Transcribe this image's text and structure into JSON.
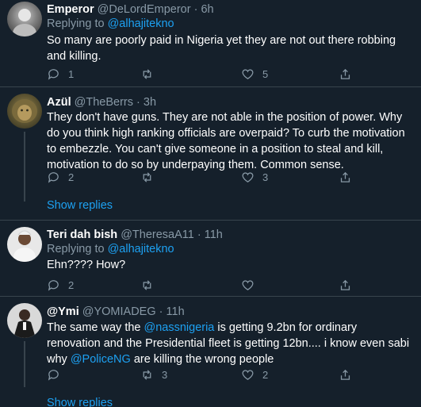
{
  "tweets": [
    {
      "name": "Emperor",
      "handle": "@DeLordEmperor",
      "time": "· 6h",
      "replying_prefix": "Replying to ",
      "replying_to": "@alhajitekno",
      "text": "So many are poorly paid in Nigeria yet they are not out there robbing and killing.",
      "replies": "1",
      "retweets": "",
      "likes": "5",
      "avatar_icon": "avatar-photo-icon"
    },
    {
      "name": "Azül",
      "handle": "@TheBerrs",
      "time": "· 3h",
      "text": "They don't have guns. They are not able in the position of power. Why do you think high ranking officials are overpaid? To curb the motivation to embezzle. You can't give someone in a position to steal and kill, motivation to do so by underpaying them. Common sense.",
      "replies": "2",
      "retweets": "",
      "likes": "3",
      "show_replies": "Show replies",
      "avatar_icon": "lion-avatar-icon"
    },
    {
      "name": "Teri dah bish",
      "handle": "@TheresaA11",
      "time": "· 11h",
      "replying_prefix": "Replying to ",
      "replying_to": "@alhajitekno",
      "text": "Ehn???? How?",
      "replies": "2",
      "retweets": "",
      "likes": "",
      "avatar_icon": "avatar-photo-icon"
    },
    {
      "name": "@Ymi",
      "handle": "@YOMIADEG",
      "time": "· 11h",
      "text_parts": {
        "a": "The same way the ",
        "mention1": "@nassnigeria",
        "b": " is getting 9.2bn for ordinary renovation and the Presidential fleet is getting 12bn.... i know even sabi why ",
        "mention2": "@PoliceNG",
        "c": " are killing the wrong people"
      },
      "replies": "",
      "retweets": "3",
      "likes": "2",
      "show_replies": "Show replies",
      "avatar_icon": "avatar-photo-icon"
    }
  ],
  "colors": {
    "background": "#15202b",
    "secondary_text": "#8899a6",
    "link": "#1da1f2",
    "divider": "#38444d"
  }
}
